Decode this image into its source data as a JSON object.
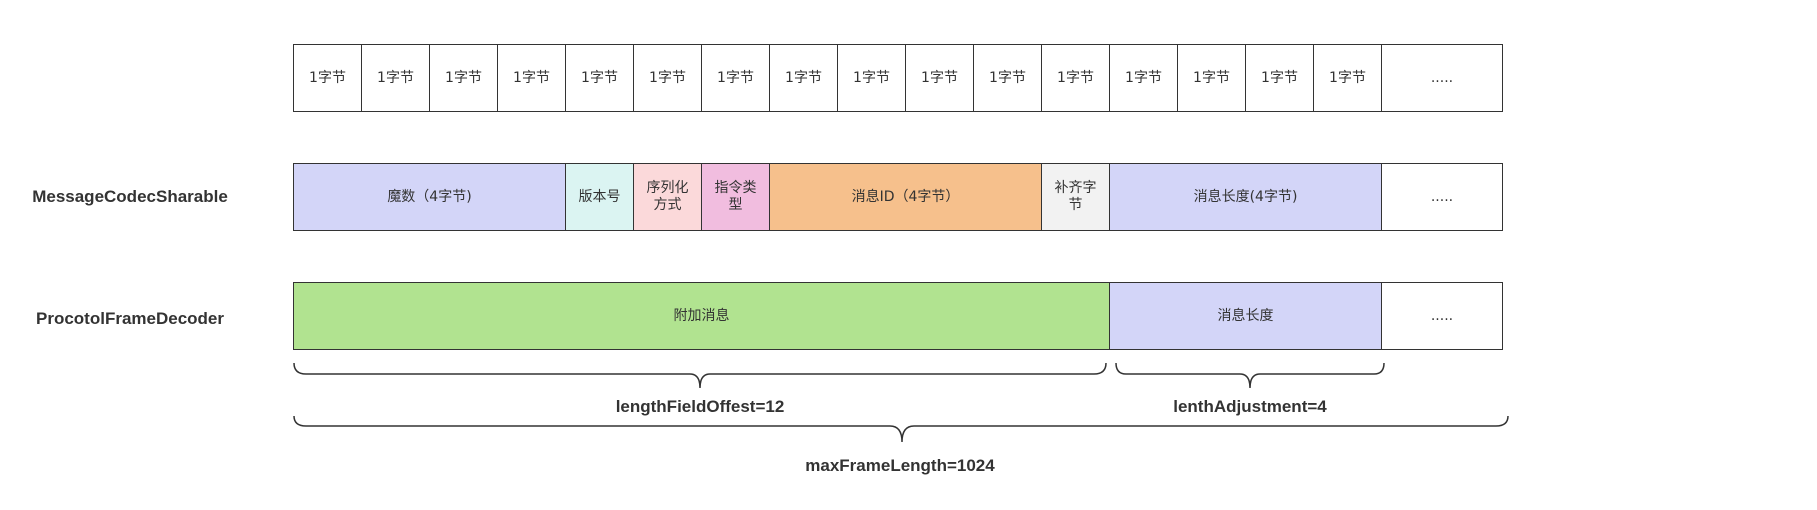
{
  "byte_row": {
    "cells": [
      "1字节",
      "1字节",
      "1字节",
      "1字节",
      "1字节",
      "1字节",
      "1字节",
      "1字节",
      "1字节",
      "1字节",
      "1字节",
      "1字节",
      "1字节",
      "1字节",
      "1字节",
      "1字节"
    ],
    "more": "....."
  },
  "codec_row": {
    "label": "MessageCodecSharable",
    "fields": [
      {
        "text": "魔数（4字节)",
        "color": "#d3d5f8"
      },
      {
        "text": "版本号",
        "color": "#dbf4f2"
      },
      {
        "text": "序列化方式",
        "color": "#fbd9da"
      },
      {
        "text": "指令类型",
        "color": "#f1bddf"
      },
      {
        "text": "消息ID（4字节）",
        "color": "#f6c08c"
      },
      {
        "text": "补齐字节",
        "color": "#f2f2f2"
      },
      {
        "text": "消息长度(4字节)",
        "color": "#d3d5f8"
      }
    ],
    "more": "....."
  },
  "decoder_row": {
    "label": "ProcotolFrameDecoder",
    "fields": [
      {
        "text": "附加消息",
        "color": "#b1e390"
      },
      {
        "text": "消息长度",
        "color": "#d3d5f8"
      }
    ],
    "more": "....."
  },
  "braces": {
    "length_field_offset": "lengthFieldOffest=12",
    "length_adjustment": "lenthAdjustment=4",
    "max_frame_length": "maxFrameLength=1024"
  }
}
